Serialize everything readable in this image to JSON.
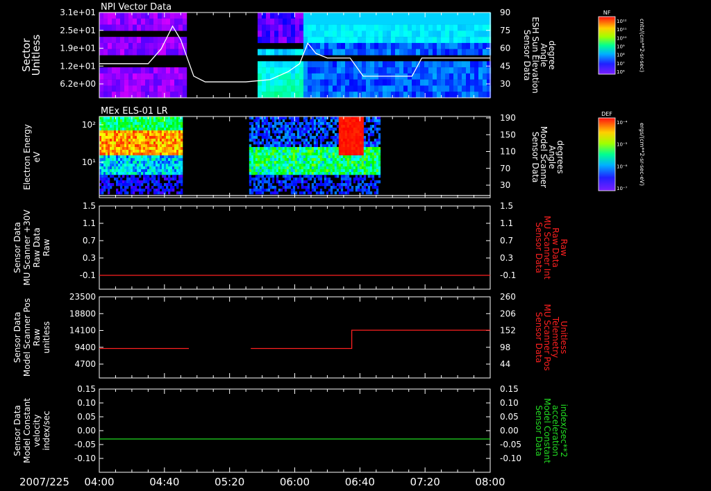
{
  "date_label": "2007/225",
  "colors": {
    "axis": "#ffffff",
    "red": "#ff2020",
    "green": "#22dd22",
    "bg": "#000000"
  },
  "chart_data": [
    {
      "type": "heatmap",
      "title": "NPI Vector Data",
      "ylabel_left": [
        "Sector",
        "Unitless"
      ],
      "yticks_left": [
        "3.1e+01",
        "2.5e+01",
        "1.9e+01",
        "1.2e+01",
        "6.2e+00"
      ],
      "ylabel_right": [
        "Sensor Data",
        "ESH Sun Elevation",
        "Angle",
        "degree"
      ],
      "yticks_right": [
        "90",
        "75",
        "60",
        "45",
        "30"
      ],
      "yrange_right": [
        15,
        90
      ],
      "overlay_line": {
        "name": "ESH Sun Elevation Angle",
        "x": [
          "04:00",
          "04:30",
          "04:38",
          "04:45",
          "04:50",
          "04:58",
          "05:05",
          "05:30",
          "05:45",
          "05:56",
          "06:03",
          "06:08",
          "06:13",
          "06:20",
          "06:34",
          "06:42",
          "07:05",
          "07:12",
          "07:18",
          "07:35",
          "08:00"
        ],
        "y": [
          45,
          45,
          58,
          78,
          66,
          34,
          29,
          29,
          31,
          38,
          45,
          63,
          54,
          50,
          50,
          34,
          34,
          34,
          50,
          50,
          50
        ]
      },
      "colorbar": {
        "label": "NF",
        "units": "cnts/(cm**2-sr-sec)",
        "ticks": [
          "10¹²",
          "10¹¹",
          "10¹⁰",
          "10⁹",
          "10⁸",
          "10⁷",
          "10⁶"
        ]
      }
    },
    {
      "type": "heatmap",
      "title": "MEx ELS-01 LR",
      "ylabel_left": [
        "Electron Energy",
        "eV"
      ],
      "yticks_left": [
        "10²",
        "10¹"
      ],
      "ylabel_right": [
        "Sensor Data",
        "Model Scanner",
        "Angle",
        "degrees"
      ],
      "yticks_right": [
        "190",
        "150",
        "110",
        "70",
        "30"
      ],
      "yrange_right": [
        0,
        190
      ],
      "overlay_line": {
        "name": "Model Scanner Angle",
        "x": [
          "04:00",
          "08:00"
        ],
        "y": [
          5,
          5
        ]
      },
      "colorbar": {
        "label": "DEF",
        "units": "ergs/(cm**2-sr-sec-eV)",
        "ticks": [
          "10⁻⁴",
          "10⁻⁵",
          "10⁻⁶",
          "10⁻⁷"
        ]
      }
    },
    {
      "type": "line",
      "ylabel_left": [
        "Sensor Data",
        "MU Scanner +30V",
        "Raw Data",
        "Raw"
      ],
      "yticks_left": [
        "1.5",
        "1.1",
        "0.7",
        "0.3",
        "-0.1"
      ],
      "ylabel_right": [
        "Sensor Data",
        "MU Scanner Int",
        "Raw Data",
        "Raw"
      ],
      "yticks_right": [
        "1.5",
        "1.1",
        "0.7",
        "0.3",
        "-0.1"
      ],
      "ylim": [
        -0.3,
        1.5
      ],
      "series": [
        {
          "name": "MU Scanner Int Raw Data",
          "color": "#ff2020",
          "x": [
            "04:00",
            "08:00"
          ],
          "y": [
            0.0,
            0.0
          ]
        }
      ]
    },
    {
      "type": "line",
      "ylabel_left": [
        "Sensor Data",
        "Model Scanner Pos",
        "Raw",
        "unitless"
      ],
      "yticks_left": [
        "23500",
        "18800",
        "14100",
        "9400",
        "4700"
      ],
      "ylabel_right": [
        "Sensor Data",
        "MU Scanner Pos",
        "Telemetry",
        "Unitless"
      ],
      "yticks_right": [
        "260",
        "206",
        "152",
        "98",
        "44"
      ],
      "ylim_right": [
        -10,
        260
      ],
      "series": [
        {
          "name": "MU Scanner Pos Telemetry",
          "color": "#ff2020",
          "segments": [
            {
              "x": [
                "04:00",
                "04:55"
              ],
              "y": [
                88,
                88
              ]
            },
            {
              "x": [
                "05:33",
                "06:35",
                "06:35",
                "08:00"
              ],
              "y": [
                88,
                88,
                149,
                149
              ]
            }
          ]
        }
      ]
    },
    {
      "type": "line",
      "ylabel_left": [
        "Sensor Data",
        "Model Constant",
        "velocity",
        "index/sec"
      ],
      "yticks_left": [
        "0.15",
        "0.10",
        "0.05",
        "0.00",
        "-0.05",
        "-0.10"
      ],
      "ylabel_right": [
        "Sensor Data",
        "Model Constant",
        "acceleration",
        "index/sec**2"
      ],
      "yticks_right": [
        "0.15",
        "0.10",
        "0.05",
        "0.00",
        "-0.05",
        "-0.10"
      ],
      "ylim": [
        -0.1,
        0.15
      ],
      "series": [
        {
          "name": "Model Constant acceleration",
          "color": "#22dd22",
          "x": [
            "04:00",
            "08:00"
          ],
          "y": [
            0.0,
            0.0
          ]
        }
      ]
    }
  ],
  "x_axis": {
    "ticks": [
      "04:00",
      "04:40",
      "05:20",
      "06:00",
      "06:40",
      "07:20",
      "08:00"
    ],
    "range": [
      "04:00",
      "08:00"
    ]
  }
}
